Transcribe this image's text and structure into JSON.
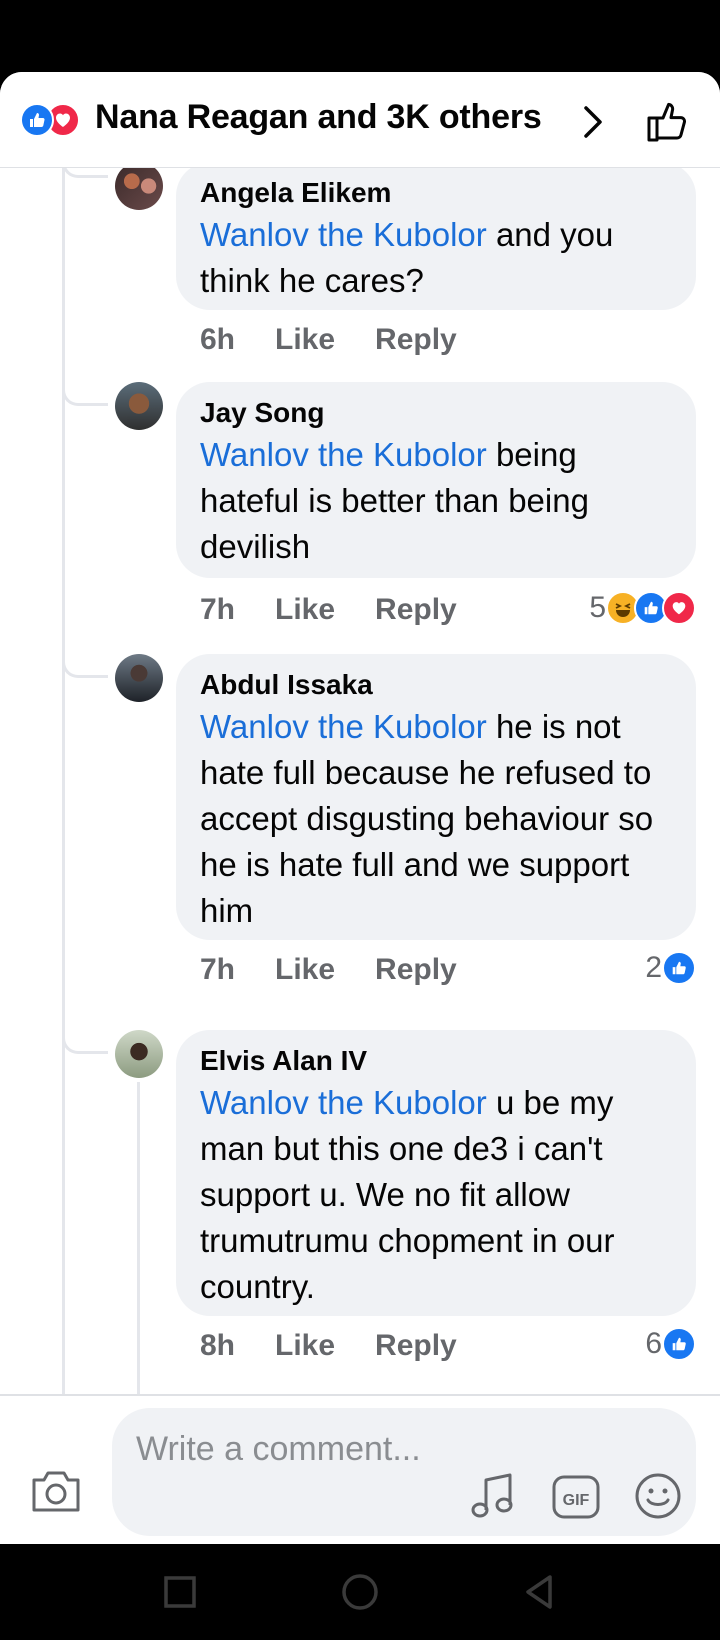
{
  "header": {
    "reacts_summary": "Nana Reagan and 3K others",
    "reaction_icons": [
      "like-icon",
      "love-icon"
    ]
  },
  "comments": [
    {
      "author": "Angela Elikem",
      "mention": "Wanlov the Kubolor",
      "text": " and you think he cares?",
      "time": "6h",
      "like_label": "Like",
      "reply_label": "Reply",
      "reaction_count": "",
      "reaction_icons": []
    },
    {
      "author": "Jay Song",
      "mention": "Wanlov the Kubolor",
      "text": " being hateful is better than being devilish",
      "time": "7h",
      "like_label": "Like",
      "reply_label": "Reply",
      "reaction_count": "5",
      "reaction_icons": [
        "haha-icon",
        "like-icon",
        "love-icon"
      ]
    },
    {
      "author": "Abdul Issaka",
      "mention": "Wanlov the Kubolor",
      "text": " he is not hate full because he refused to accept disgusting behaviour so he is hate full and we support him",
      "time": "7h",
      "like_label": "Like",
      "reply_label": "Reply",
      "reaction_count": "2",
      "reaction_icons": [
        "like-icon"
      ]
    },
    {
      "author": "Elvis Alan IV",
      "mention": "Wanlov the Kubolor",
      "text": " u be my man but this one de3 i can't support u. We no fit allow trumutrumu chopment in our country.",
      "time": "8h",
      "like_label": "Like",
      "reply_label": "Reply",
      "reaction_count": "6",
      "reaction_icons": [
        "like-icon"
      ]
    }
  ],
  "composer": {
    "placeholder": "Write a comment..."
  },
  "colors": {
    "brand_blue": "#1877f2",
    "mention_blue": "#1a6ed8",
    "love_red": "#f02849",
    "bubble_bg": "#f0f2f5",
    "meta_gray": "#65676b"
  },
  "navbar": {
    "icons": [
      "recents-square-icon",
      "home-circle-icon",
      "back-triangle-icon"
    ]
  }
}
